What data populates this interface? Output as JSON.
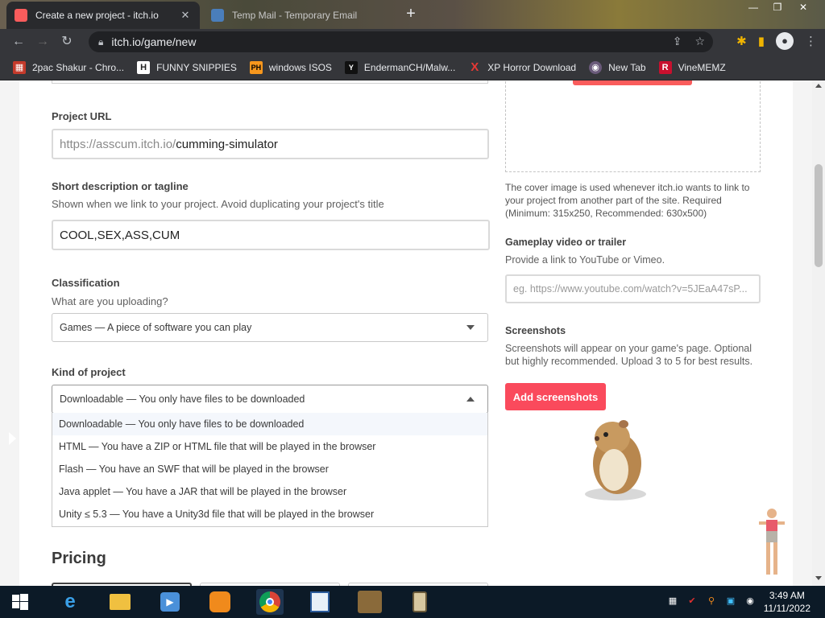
{
  "browser": {
    "tabs": [
      {
        "title": "Create a new project - itch.io",
        "favicon_color": "#fa5c5c"
      },
      {
        "title": "Temp Mail - Temporary Email",
        "favicon_color": "#4a7ebb"
      }
    ],
    "url": "itch.io/game/new",
    "bookmarks": [
      {
        "label": "2pac Shakur - Chro...",
        "icon": "H",
        "icon_bg": "#c43a2b"
      },
      {
        "label": "FUNNY SNIPPIES",
        "icon": "H",
        "icon_bg": "#222"
      },
      {
        "label": "windows ISOS",
        "icon": "PH",
        "icon_bg": "#f7971d"
      },
      {
        "label": "EndermanCH/Malw...",
        "icon": "Y",
        "icon_bg": "#111"
      },
      {
        "label": "XP Horror Download",
        "icon": "X",
        "icon_bg": "#35363a"
      },
      {
        "label": "New Tab",
        "icon": "◉",
        "icon_bg": "#5a4a6a"
      },
      {
        "label": "VineMEMZ",
        "icon": "R",
        "icon_bg": "#c8102e"
      }
    ]
  },
  "form": {
    "project_url": {
      "label": "Project URL",
      "prefix": "https://asscum.itch.io/",
      "value": "cumming-simulator"
    },
    "short_description": {
      "label": "Short description or tagline",
      "help": "Shown when we link to your project. Avoid duplicating your project's title",
      "value": "COOL,SEX,ASS,CUM"
    },
    "classification": {
      "label": "Classification",
      "help": "What are you uploading?",
      "value": "Games — A piece of software you can play"
    },
    "kind": {
      "label": "Kind of project",
      "value": "Downloadable — You only have files to be downloaded",
      "options": [
        "Downloadable — You only have files to be downloaded",
        "HTML — You have a ZIP or HTML file that will be played in the browser",
        "Flash — You have an SWF that will be played in the browser",
        "Java applet — You have a JAR that will be played in the browser",
        "Unity ≤ 5.3 — You have a Unity3d file that will be played in the browser"
      ]
    },
    "pricing": {
      "heading": "Pricing"
    }
  },
  "sidebar": {
    "cover_note": "The cover image is used whenever itch.io wants to link to your project from another part of the site. Required (Minimum: 315x250, Recommended: 630x500)",
    "video": {
      "label": "Gameplay video or trailer",
      "help": "Provide a link to YouTube or Vimeo.",
      "placeholder": "eg. https://www.youtube.com/watch?v=5JEaA47sP..."
    },
    "screenshots": {
      "label": "Screenshots",
      "help": "Screenshots will appear on your game's page. Optional but highly recommended. Upload 3 to 5 for best results.",
      "button": "Add screenshots"
    }
  },
  "taskbar": {
    "time": "3:49 AM",
    "date": "11/11/2022"
  }
}
